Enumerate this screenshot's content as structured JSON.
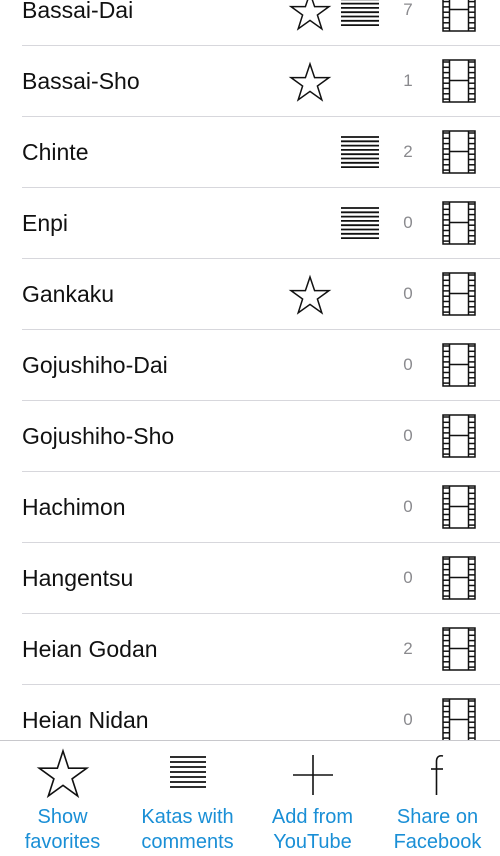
{
  "katas": [
    {
      "name": "Bassai-Dai",
      "favorite": true,
      "has_comments": true,
      "count": "7"
    },
    {
      "name": "Bassai-Sho",
      "favorite": true,
      "has_comments": false,
      "count": "1"
    },
    {
      "name": "Chinte",
      "favorite": false,
      "has_comments": true,
      "count": "2"
    },
    {
      "name": "Enpi",
      "favorite": false,
      "has_comments": true,
      "count": "0"
    },
    {
      "name": "Gankaku",
      "favorite": true,
      "has_comments": false,
      "count": "0"
    },
    {
      "name": "Gojushiho-Dai",
      "favorite": false,
      "has_comments": false,
      "count": "0"
    },
    {
      "name": "Gojushiho-Sho",
      "favorite": false,
      "has_comments": false,
      "count": "0"
    },
    {
      "name": "Hachimon",
      "favorite": false,
      "has_comments": false,
      "count": "0"
    },
    {
      "name": "Hangentsu",
      "favorite": false,
      "has_comments": false,
      "count": "0"
    },
    {
      "name": "Heian Godan",
      "favorite": false,
      "has_comments": false,
      "count": "2"
    },
    {
      "name": "Heian Nidan",
      "favorite": false,
      "has_comments": false,
      "count": "0"
    }
  ],
  "tabbar": {
    "show_favorites": "Show\nfavorites",
    "katas_with_comments": "Katas with\ncomments",
    "add_from_youtube": "Add from\nYouTube",
    "share_on_facebook": "Share on\nFacebook"
  },
  "colors": {
    "accent": "#1a8fd6",
    "separator": "#d7d7dc",
    "count_text": "#8a8a8e"
  },
  "icons": {
    "favorite": "star-icon",
    "comments": "lines-icon",
    "video": "film-icon",
    "add": "plus-icon",
    "share": "facebook-f-icon"
  }
}
